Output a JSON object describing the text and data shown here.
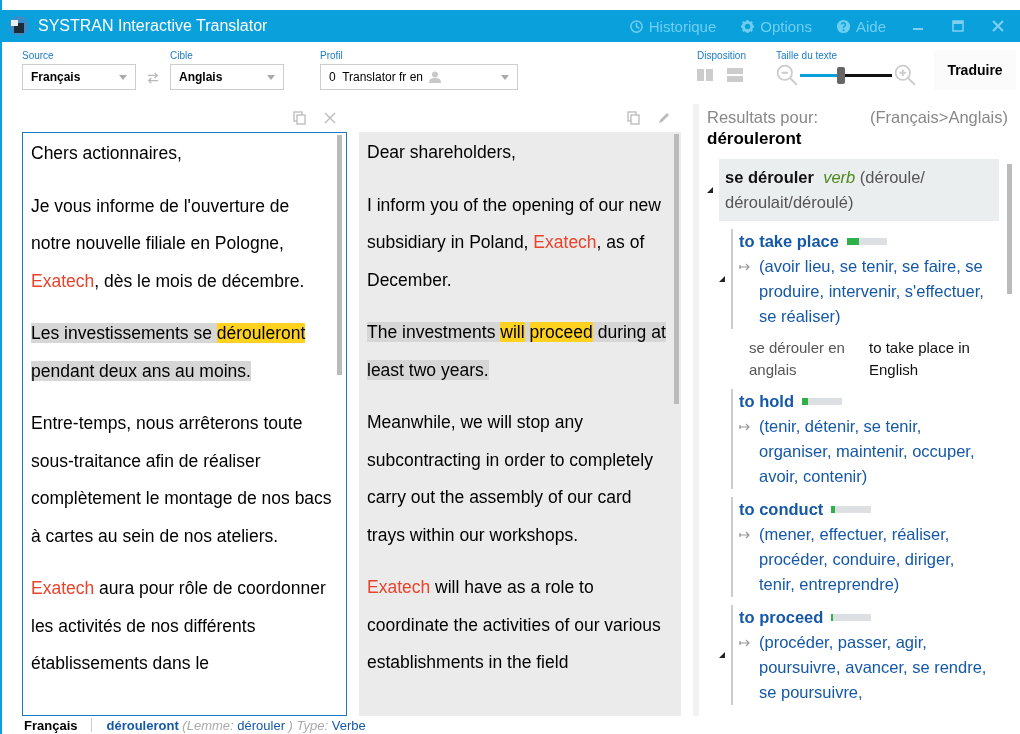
{
  "window": {
    "title": "SYSTRAN Interactive Translator",
    "menu": [
      {
        "label": "Historique",
        "kind": "history"
      },
      {
        "label": "Options",
        "kind": "options"
      },
      {
        "label": "Aide",
        "kind": "help"
      }
    ]
  },
  "toolbar": {
    "source": {
      "label": "Source",
      "value": "Français"
    },
    "target": {
      "label": "Cible",
      "value": "Anglais"
    },
    "profile": {
      "label": "Profil",
      "value": "0  Translator fr en"
    },
    "layout": {
      "label": "Disposition"
    },
    "text_size": {
      "label": "Taille du texte",
      "level": 0.45
    },
    "translate_button": "Traduire"
  },
  "source_text": [
    [
      {
        "text": "Chers actionnaires,",
        "kind": "plain"
      }
    ],
    [
      {
        "text": "Je vous informe de l'ouverture de notre nouvelle filiale en Pologne, ",
        "kind": "plain"
      },
      {
        "text": "Exatech",
        "kind": "entity"
      },
      {
        "text": ", dès le mois de décembre.",
        "kind": "plain"
      }
    ],
    [
      {
        "text": "Les investissements se ",
        "kind": "selected"
      },
      {
        "text": "dérouleront",
        "kind": "match"
      },
      {
        "text": " pendant deux ans au moins.",
        "kind": "selected"
      }
    ],
    [
      {
        "text": "Entre-temps, nous arrêterons toute sous-traitance afin de réaliser complètement le montage de nos bacs à cartes au sein de nos ateliers.",
        "kind": "plain"
      }
    ],
    [
      {
        "text": "Exatech",
        "kind": "entity"
      },
      {
        "text": " aura pour rôle de coordonner les activités de nos différents établissements dans le",
        "kind": "plain"
      }
    ]
  ],
  "target_text": [
    [
      {
        "text": "Dear shareholders,",
        "kind": "plain"
      }
    ],
    [
      {
        "text": "I inform you of the opening of our new subsidiary in Poland, ",
        "kind": "plain"
      },
      {
        "text": "Exatech",
        "kind": "entity"
      },
      {
        "text": ", as of December.",
        "kind": "plain"
      }
    ],
    [
      {
        "text": "The investments ",
        "kind": "selected"
      },
      {
        "text": "will",
        "kind": "match"
      },
      {
        "text": "proceed",
        "kind": "match"
      },
      {
        "text": " during at least two years.",
        "kind": "selected"
      }
    ],
    [
      {
        "text": "Meanwhile, we will stop any subcontracting in order to completely carry out the assembly of our card trays within our workshops.",
        "kind": "plain"
      }
    ],
    [
      {
        "text": "Exatech",
        "kind": "entity"
      },
      {
        "text": " will have as a role to coordinate the activities of our various establishments in the field",
        "kind": "plain"
      }
    ]
  ],
  "dictionary": {
    "results_label": "Resultats pour:",
    "direction": "(Français>Anglais)",
    "word": "dérouleront",
    "entry": {
      "lemma": "se dérouler",
      "pos": "verb",
      "forms": "(déroule/ déroulait/déroulé)",
      "expanded": true,
      "senses": [
        {
          "translation": "to take place",
          "level": 0.3,
          "synonyms": "(avoir lieu, se tenir, se faire, se produire, intervenir, s'effectuer, se réaliser)",
          "toggle": true,
          "example": {
            "source": "se dérouler en anglais",
            "target": "to take place in English"
          }
        },
        {
          "translation": "to hold",
          "level": 0.15,
          "synonyms": "(tenir, détenir, se tenir, organiser, maintenir, occuper, avoir, contenir)",
          "toggle": false
        },
        {
          "translation": "to conduct",
          "level": 0.1,
          "synonyms": "(mener, effectuer, réaliser, procéder, conduire, diriger, tenir, entreprendre)",
          "toggle": false
        },
        {
          "translation": "to proceed",
          "level": 0.04,
          "synonyms": "(procéder, passer, agir, poursuivre, avancer, se rendre, se poursuivre,",
          "toggle": true
        }
      ]
    }
  },
  "status_bar": {
    "language": "Français",
    "details": [
      {
        "text": "dérouleront",
        "kind": "word"
      },
      {
        "text": "(Lemme:",
        "kind": "label"
      },
      {
        "text": "dérouler",
        "kind": "value"
      },
      {
        "text": ")",
        "kind": "label"
      },
      {
        "text": "Type:",
        "kind": "label"
      },
      {
        "text": "Verbe",
        "kind": "value"
      }
    ]
  }
}
